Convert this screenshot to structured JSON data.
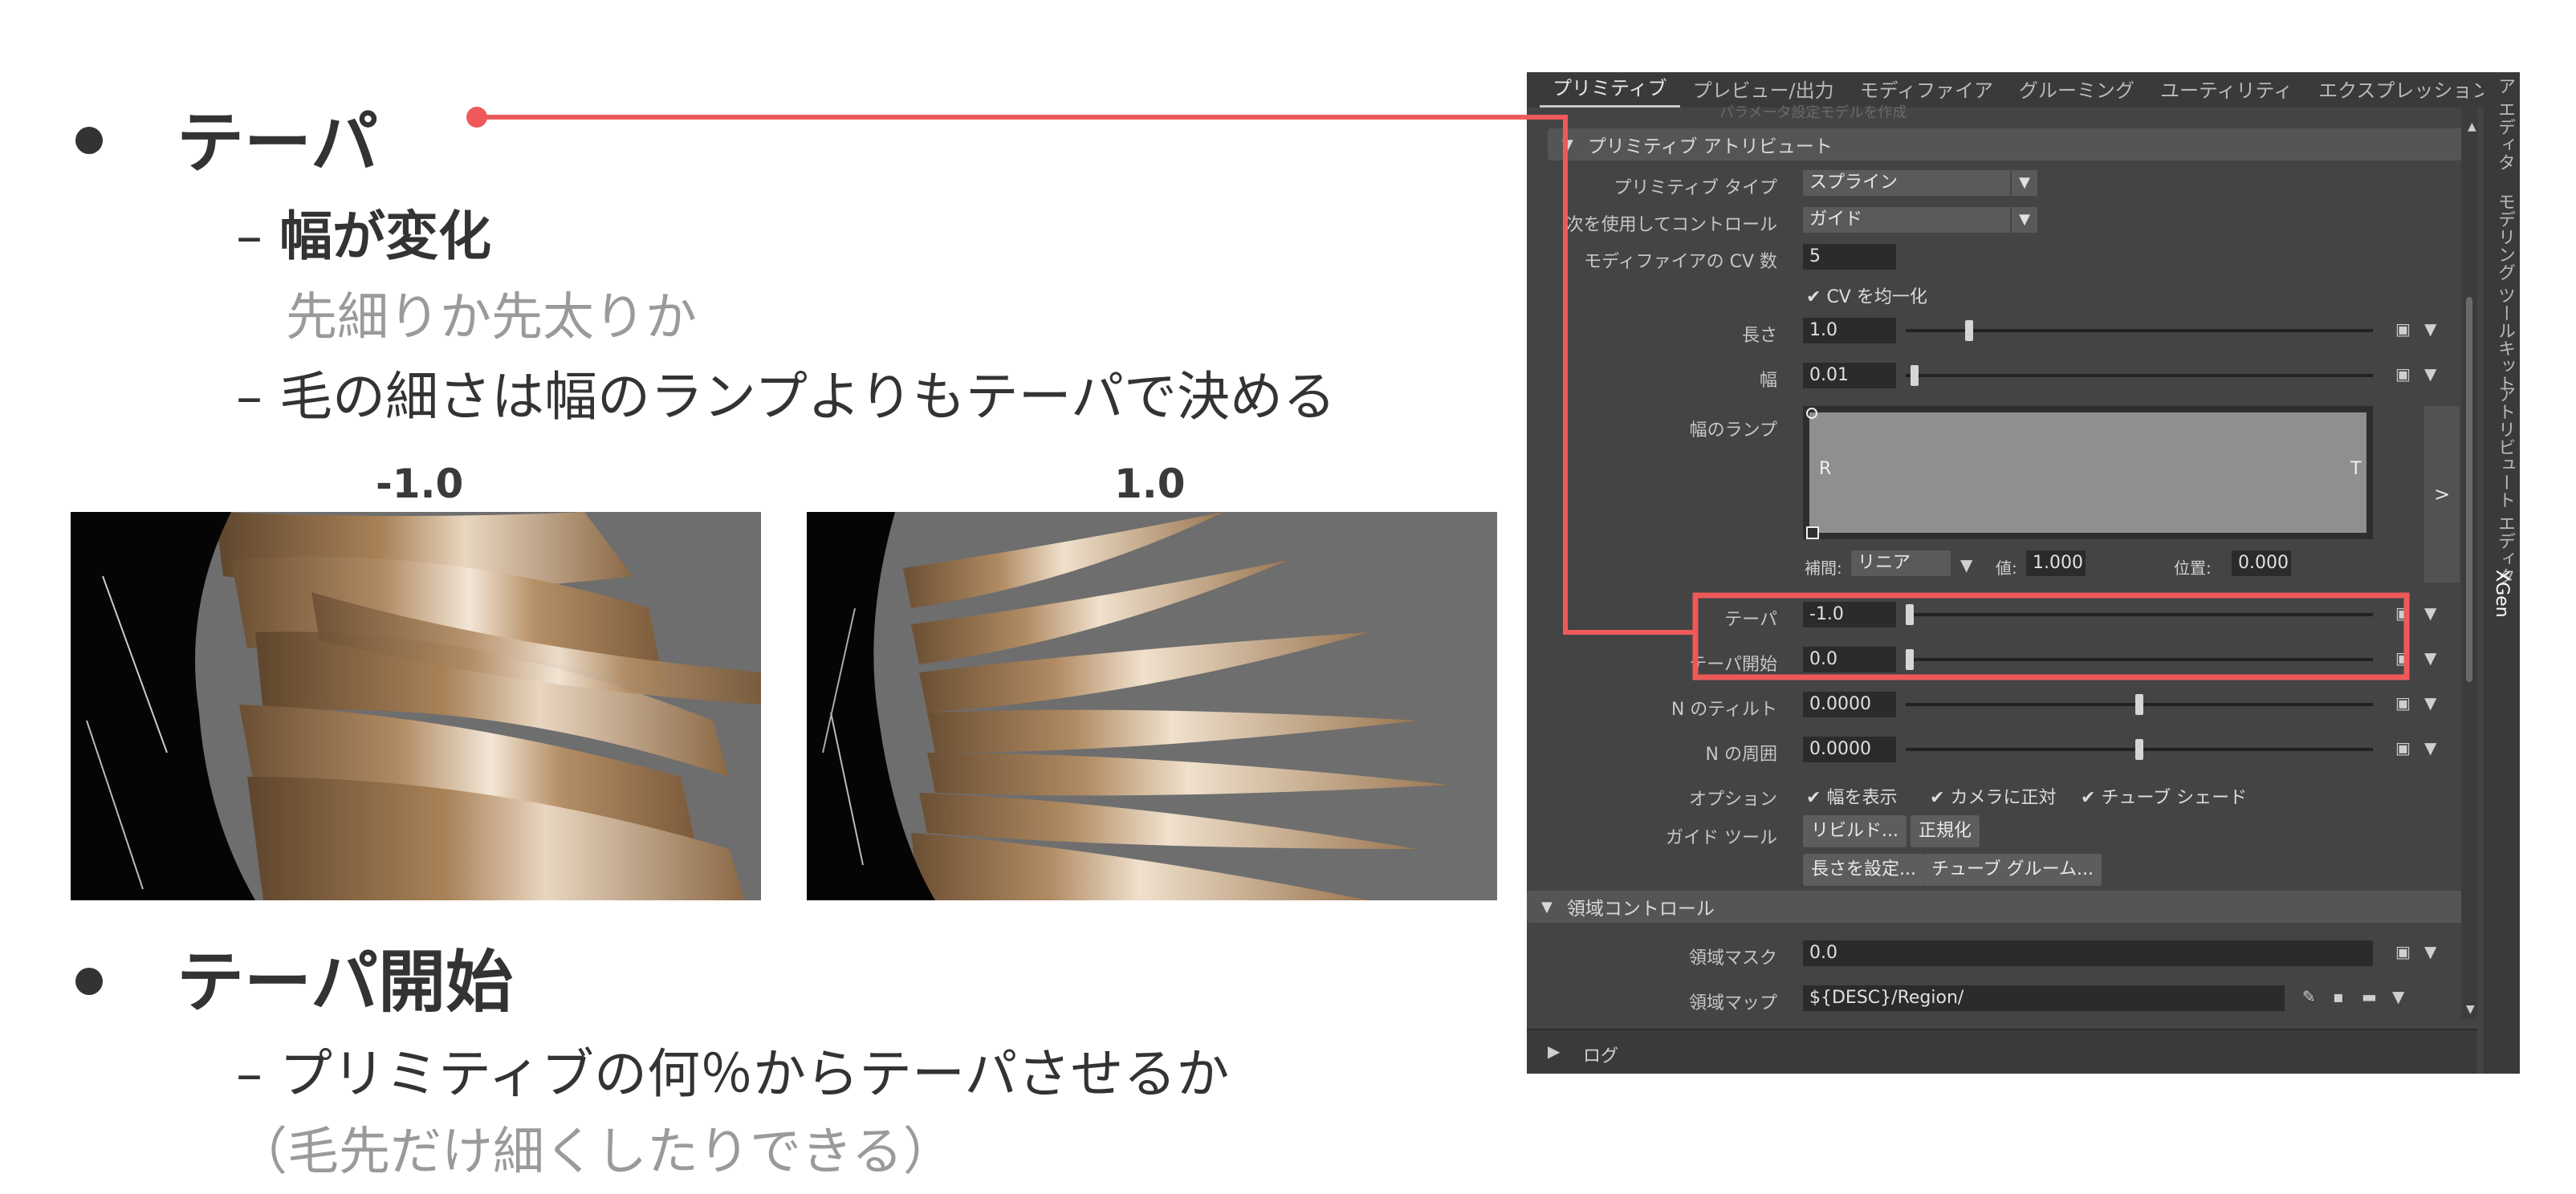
{
  "slide": {
    "bullet1": {
      "title": "テーパ",
      "sub1_title": "幅が変化",
      "sub1_note": "先細りか先太りか",
      "sub2": "毛の細さは幅のランプよりもテーパで決める"
    },
    "images": {
      "left_caption": "-1.0",
      "right_caption": "1.0"
    },
    "bullet2": {
      "title": "テーパ開始",
      "sub1": "プリミティブの何％からテーパさせるか",
      "note": "（毛先だけ細くしたりできる）"
    },
    "dash": "–"
  },
  "panel": {
    "tabs": [
      "プリミティブ",
      "プレビュー/出力",
      "モディファイア",
      "グルーミング",
      "ユーティリティ",
      "エクスプレッション"
    ],
    "faded_text": "パラメータ設定モデルを作成",
    "section1": "プリミティブ アトリビュート",
    "rows": {
      "prim_type_label": "プリミティブ タイプ",
      "prim_type_value": "スプライン",
      "control_label": "次を使用してコントロール",
      "control_value": "ガイド",
      "cv_label": "モディファイアの CV 数",
      "cv_value": "5",
      "cv_uniform": "CV を均一化",
      "length_label": "長さ",
      "length_value": "1.0",
      "width_label": "幅",
      "width_value": "0.01",
      "ramp_label": "幅のランプ",
      "ramp_r": "R",
      "ramp_t": "T",
      "ramp_expand": ">",
      "interp_label": "補間:",
      "interp_value": "リニア",
      "val_label": "値:",
      "val_value": "1.000",
      "pos_label": "位置:",
      "pos_value": "0.000",
      "taper_label": "テーパ",
      "taper_value": "-1.0",
      "taper_start_label": "テーパ開始",
      "taper_start_value": "0.0",
      "ntilt_label": "N のティルト",
      "ntilt_value": "0.0000",
      "naround_label": "N の周囲",
      "naround_value": "0.0000",
      "options_label": "オプション",
      "opt_width": "幅を表示",
      "opt_camera": "カメラに正対",
      "opt_tube": "チューブ シェード",
      "guide_tool_label": "ガイド ツール",
      "btn_rebuild": "リビルド...",
      "btn_normalize": "正規化",
      "btn_set_length": "長さを設定...",
      "btn_tube_groom": "チューブ グルーム..."
    },
    "sliders": {
      "length": 0.13,
      "width": 0.01,
      "taper": 0.0,
      "taper_start": 0.0,
      "ntilt": 0.5,
      "naround": 0.5
    },
    "section2": "領域コントロール",
    "region_mask_label": "領域マスク",
    "region_mask_value": "0.0",
    "region_map_label": "領域マップ",
    "region_map_value": "${DESC}/Region/",
    "log_label": "ログ",
    "side_tabs": [
      "ア エディタ",
      "モデリング ツールキット",
      "アトリビュート エディタ",
      "XGen"
    ]
  },
  "colors": {
    "callout": "#ee5a5a",
    "panel_bg": "#444444"
  }
}
